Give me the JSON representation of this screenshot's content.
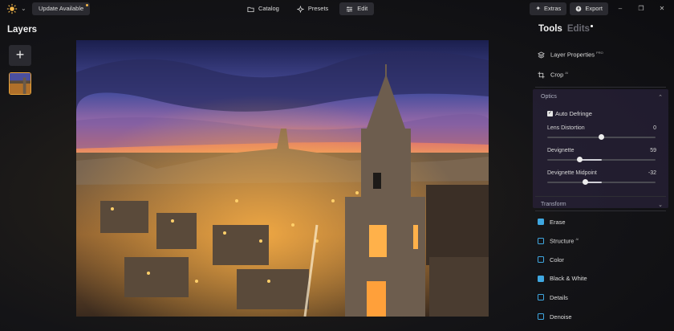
{
  "app": {
    "logo_icon": "sun-logo-icon",
    "update_label": "Update Available",
    "accent": "#f5b84a"
  },
  "mode_tabs": [
    {
      "label": "Catalog",
      "icon": "folder-icon"
    },
    {
      "label": "Presets",
      "icon": "sparkle-icon"
    },
    {
      "label": "Edit",
      "icon": "sliders-icon",
      "active": true
    }
  ],
  "top_right": {
    "extras_label": "Extras",
    "export_label": "Export"
  },
  "layers": {
    "title": "Layers",
    "add_symbol": "+"
  },
  "panel": {
    "tab_tools": "Tools",
    "tab_edits": "Edits",
    "layer_properties": {
      "label": "Layer Properties",
      "badge": "PRO"
    },
    "crop": {
      "label": "Crop",
      "badge": "AI"
    },
    "optics": {
      "title": "Optics",
      "auto_defringe": {
        "label": "Auto Defringe",
        "checked": true
      },
      "sliders": [
        {
          "label": "Lens Distortion",
          "value": "0",
          "position": 0.5
        },
        {
          "label": "Devignette",
          "value": "59",
          "position": 0.3
        },
        {
          "label": "Devignette Midpoint",
          "value": "-32",
          "position": 0.35
        }
      ]
    },
    "transform": {
      "title": "Transform"
    },
    "tools": [
      {
        "label": "Erase",
        "badge": "",
        "color": "#3fa7e0"
      },
      {
        "label": "Structure",
        "badge": "AI",
        "color": "#3fa7e0"
      },
      {
        "label": "Color",
        "badge": "",
        "color": "#3fa7e0"
      },
      {
        "label": "Black & White",
        "badge": "",
        "color": "#3fa7e0"
      },
      {
        "label": "Details",
        "badge": "",
        "color": "#3fa7e0"
      },
      {
        "label": "Denoise",
        "badge": "",
        "color": "#3fa7e0"
      }
    ]
  }
}
